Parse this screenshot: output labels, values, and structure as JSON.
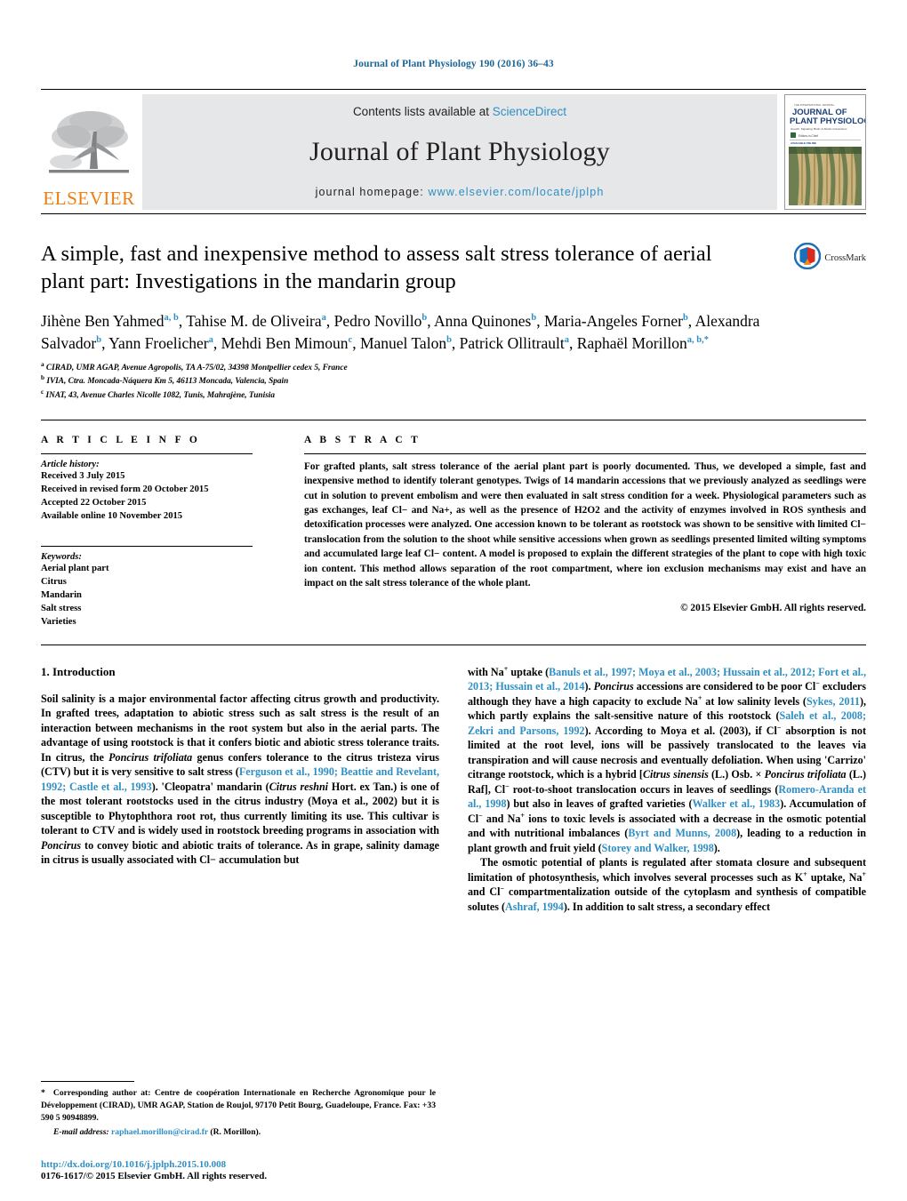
{
  "running_head": "Journal of Plant Physiology 190 (2016) 36–43",
  "masthead": {
    "contents_prefix": "Contents lists available at ",
    "sciencedirect": "ScienceDirect",
    "journal_title": "Journal of Plant Physiology",
    "homepage_prefix": "journal homepage: ",
    "homepage_url": "www.elsevier.com/locate/jplph",
    "publisher": "ELSEVIER",
    "publisher_logo_icon": "elsevier-tree-icon",
    "cover_icon": "journal-cover-thumbnail",
    "cover_title_line1": "JOURNAL OF",
    "cover_title_line2": "PLANT PHYSIOLOGY"
  },
  "article": {
    "title": "A simple, fast and inexpensive method to assess salt stress tolerance of aerial plant part: Investigations in the mandarin group",
    "crossmark_label": "CrossMark",
    "crossmark_icon": "crossmark-logo-icon",
    "authors_html": "Jihène Ben Yahmed<sup>a, b</sup>, Tahise M. de Oliveira<sup>a</sup>, Pedro Novillo<sup>b</sup>, Anna Quinones<sup>b</sup>, Maria-Angeles Forner<sup>b</sup>, Alexandra Salvador<sup>b</sup>, Yann Froelicher<sup>a</sup>, Mehdi Ben Mimoun<sup>c</sup>, Manuel Talon<sup>b</sup>, Patrick Ollitrault<sup>a</sup>, Raphaël Morillon<sup>a, b,</sup><sup>*</sup>",
    "affiliations": [
      {
        "mark": "a",
        "text": "CIRAD, UMR AGAP, Avenue Agropolis, TA A-75/02, 34398 Montpellier cedex 5, France"
      },
      {
        "mark": "b",
        "text": "IVIA, Ctra. Moncada-Náquera Km 5, 46113 Moncada, Valencia, Spain"
      },
      {
        "mark": "c",
        "text": "INAT, 43, Avenue Charles Nicolle 1082, Tunis, Mahrajène, Tunisia"
      }
    ]
  },
  "article_info": {
    "heading": "A R T I C L E   I N F O",
    "history_label": "Article history:",
    "history": [
      "Received 3 July 2015",
      "Received in revised form 20 October 2015",
      "Accepted 22 October 2015",
      "Available online 10 November 2015"
    ],
    "keywords_label": "Keywords:",
    "keywords": [
      "Aerial plant part",
      "Citrus",
      "Mandarin",
      "Salt stress",
      "Varieties"
    ]
  },
  "abstract": {
    "heading": "A B S T R A C T",
    "text": "For grafted plants, salt stress tolerance of the aerial plant part is poorly documented. Thus, we developed a simple, fast and inexpensive method to identify tolerant genotypes. Twigs of 14 mandarin accessions that we previously analyzed as seedlings were cut in solution to prevent embolism and were then evaluated in salt stress condition for a week. Physiological parameters such as gas exchanges, leaf Cl− and Na+, as well as the presence of H2O2 and the activity of enzymes involved in ROS synthesis and detoxification processes were analyzed. One accession known to be tolerant as rootstock was shown to be sensitive with limited Cl− translocation from the solution to the shoot while sensitive accessions when grown as seedlings presented limited wilting symptoms and accumulated large leaf Cl− content. A model is proposed to explain the different strategies of the plant to cope with high toxic ion content. This method allows separation of the root compartment, where ion exclusion mechanisms may exist and have an impact on the salt stress tolerance of the whole plant.",
    "copyright": "© 2015 Elsevier GmbH. All rights reserved."
  },
  "introduction": {
    "section_number_title": "1.  Introduction",
    "left_para_1_html": "Soil salinity is a major environmental factor affecting citrus growth and productivity. In grafted trees, adaptation to abiotic stress such as salt stress is the result of an interaction between mechanisms in the root system but also in the aerial parts. The advantage of using rootstock is that it confers biotic and abiotic stress tolerance traits. In citrus, the <span class=\"it\">Poncirus trifoliata</span> genus confers tolerance to the citrus tristeza virus (CTV) but it is very sensitive to salt stress (<span class=\"ref\">Ferguson et al., 1990; Beattie and Revelant, 1992; Castle et al., 1993</span>). 'Cleopatra' mandarin (<span class=\"it\">Citrus reshni</span> Hort. ex Tan.) is one of the most tolerant rootstocks used in the citrus industry (Moya et al., 2002) but it is susceptible to Phytophthora root rot, thus currently limiting its use. This cultivar is tolerant to CTV and is widely used in rootstock breeding programs in association with <span class=\"it\">Poncirus</span> to convey biotic and abiotic traits of tolerance. As in grape, salinity damage in citrus is usually associated with Cl− accumulation but",
    "right_para_1_html": "with Na<sup class=\"tiny\">+</sup> uptake (<span class=\"ref\">Banuls et al., 1997; Moya et al., 2003; Hussain et al., 2012; Fort et al., 2013; Hussain et al., 2014</span>). <span class=\"it\">Poncirus</span> accessions are considered to be poor Cl<sup class=\"tiny\">−</sup> excluders although they have a high capacity to exclude Na<sup class=\"tiny\">+</sup> at low salinity levels (<span class=\"ref\">Sykes, 2011</span>), which partly explains the salt-sensitive nature of this rootstock (<span class=\"ref\">Saleh et al., 2008; Zekri and Parsons, 1992</span>). According to Moya et al. (2003), if Cl<sup class=\"tiny\">−</sup> absorption is not limited at the root level, ions will be passively translocated to the leaves via transpiration and will cause necrosis and eventually defoliation. When using 'Carrizo' citrange rootstock, which is a hybrid [<span class=\"it\">Citrus sinensis</span> (L.) Osb. × <span class=\"it\">Poncirus trifoliata</span> (L.) Raf], Cl<sup class=\"tiny\">−</sup> root-to-shoot translocation occurs in leaves of seedlings (<span class=\"ref\">Romero-Aranda et al., 1998</span>) but also in leaves of grafted varieties (<span class=\"ref\">Walker et al., 1983</span>). Accumulation of Cl<sup class=\"tiny\">−</sup> and Na<sup class=\"tiny\">+</sup> ions to toxic levels is associated with a decrease in the osmotic potential and with nutritional imbalances (<span class=\"ref\">Byrt and Munns, 2008</span>), leading to a reduction in plant growth and fruit yield (<span class=\"ref\">Storey and Walker, 1998</span>).",
    "right_para_2_html": "The osmotic potential of plants is regulated after stomata closure and subsequent limitation of photosynthesis, which involves several processes such as K<sup class=\"tiny\">+</sup> uptake, Na<sup class=\"tiny\">+</sup> and Cl<sup class=\"tiny\">−</sup> compartmentalization outside of the cytoplasm and synthesis of compatible solutes (<span class=\"ref\">Ashraf, 1994</span>). In addition to salt stress, a secondary effect"
  },
  "footnote": {
    "corresponding_html": "<b>*</b>&nbsp; Corresponding author at: Centre de coopération Internationale en Recherche Agronomique pour le Développement (CIRAD), UMR AGAP, Station de Roujol, 97170 Petit Bourg, Guadeloupe, France. Fax: +33 590 5 90948899.",
    "email_label": "E-mail address:",
    "email": "raphael.morillon@cirad.fr",
    "email_suffix": "(R. Morillon)."
  },
  "footer": {
    "doi": "http://dx.doi.org/10.1016/j.jplph.2015.10.008",
    "issn_copyright": "0176-1617/© 2015 Elsevier GmbH. All rights reserved."
  },
  "colors": {
    "link": "#2f8fc4",
    "elsevier_orange": "#ee7d11",
    "masthead_bg": "#e6e7e8"
  }
}
